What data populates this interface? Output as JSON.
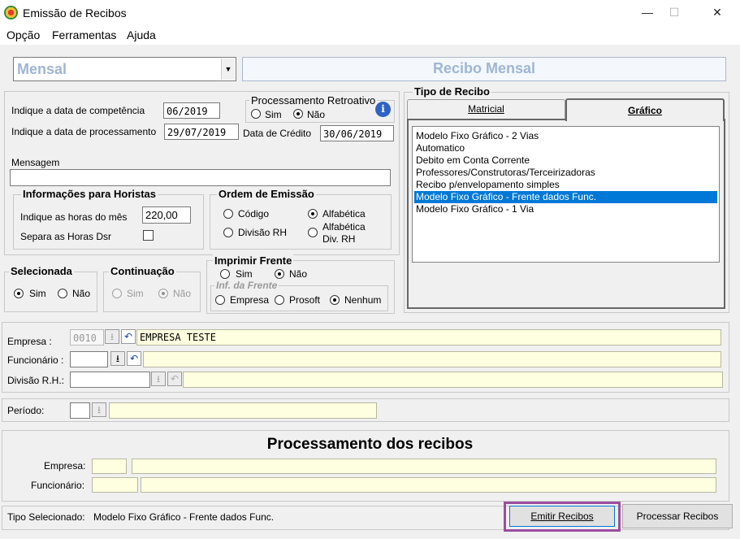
{
  "window": {
    "title": "Emissão de Recibos",
    "minimize_glyph": "—",
    "maximize_glyph": "☐",
    "close_glyph": "✕"
  },
  "menu": [
    "Opção",
    "Ferramentas",
    "Ajuda"
  ],
  "header": {
    "period_type": "Mensal",
    "receipt_title": "Recibo Mensal"
  },
  "dates": {
    "competencia_label": "Indique a data de competência",
    "competencia_value": "06/2019",
    "processamento_label": "Indique a data de processamento",
    "processamento_value": "29/07/2019",
    "credito_label": "Data de Crédito",
    "credito_value": "30/06/2019"
  },
  "retroativo": {
    "legend": "Processamento Retroativo",
    "sim": "Sim",
    "nao": "Não",
    "selected": "Não",
    "info_glyph": "i"
  },
  "mensagem": {
    "label": "Mensagem",
    "value": ""
  },
  "horistas": {
    "legend": "Informações para Horistas",
    "horas_label": "Indique as horas do mês",
    "horas_value": "220,00",
    "dsr_label": "Separa as Horas Dsr",
    "dsr_checked": false
  },
  "ordem": {
    "legend": "Ordem de Emissão",
    "codigo": "Código",
    "alfabetica": "Alfabética",
    "divisao": "Divisão RH",
    "alfa_div": "Alfabética\nDiv. RH",
    "selected": "Alfabética"
  },
  "selecionada": {
    "legend": "Selecionada",
    "sim": "Sim",
    "nao": "Não",
    "selected": "Sim"
  },
  "continuacao": {
    "legend": "Continuação",
    "sim": "Sim",
    "nao": "Não",
    "selected": "Não",
    "disabled": true
  },
  "imprimir": {
    "legend": "Imprimir Frente",
    "sim": "Sim",
    "nao": "Não",
    "selected": "Não",
    "inf_legend": "Inf. da Frente",
    "empresa": "Empresa",
    "prosoft": "Prosoft",
    "nenhum": "Nenhum",
    "inf_selected": "Nenhum"
  },
  "tipo_recibo": {
    "legend": "Tipo de Recibo",
    "tabs": [
      "Matricial",
      "Gráfico"
    ],
    "active_tab": "Gráfico",
    "items": [
      "Modelo Fixo Gráfico - 2 Vias",
      "Automatico",
      "Debito em Conta Corrente",
      "Professores/Construtoras/Terceirizadoras",
      "Recibo p/envelopamento simples",
      "Modelo Fixo Gráfico - Frente dados Func.",
      "Modelo Fixo Gráfico - 1 Via"
    ],
    "selected_index": 5
  },
  "filtros": {
    "empresa_label": "Empresa :",
    "empresa_code": "0010",
    "empresa_name": "EMPRESA TESTE",
    "funcionario_label": "Funcionário :",
    "funcionario_code": "",
    "funcionario_name": "",
    "divisao_label": "Divisão R.H.:",
    "divisao_code": "",
    "divisao_name": "",
    "periodo_label": "Período:",
    "periodo_code": "",
    "periodo_name": "",
    "download_glyph": "⭳",
    "undo_glyph": "↶"
  },
  "processamento": {
    "title": "Processamento dos recibos",
    "empresa_label": "Empresa:",
    "funcionario_label": "Funcionário:"
  },
  "status": {
    "label": "Tipo Selecionado:",
    "value": "Modelo Fixo Gráfico - Frente dados Func."
  },
  "buttons": {
    "emitir": "Emitir Recibos",
    "processar": "Processar Recibos"
  },
  "colors": {
    "highlight_border": "#9b4ea0",
    "selection": "#0078d7",
    "title_text": "#9fb6d4"
  }
}
